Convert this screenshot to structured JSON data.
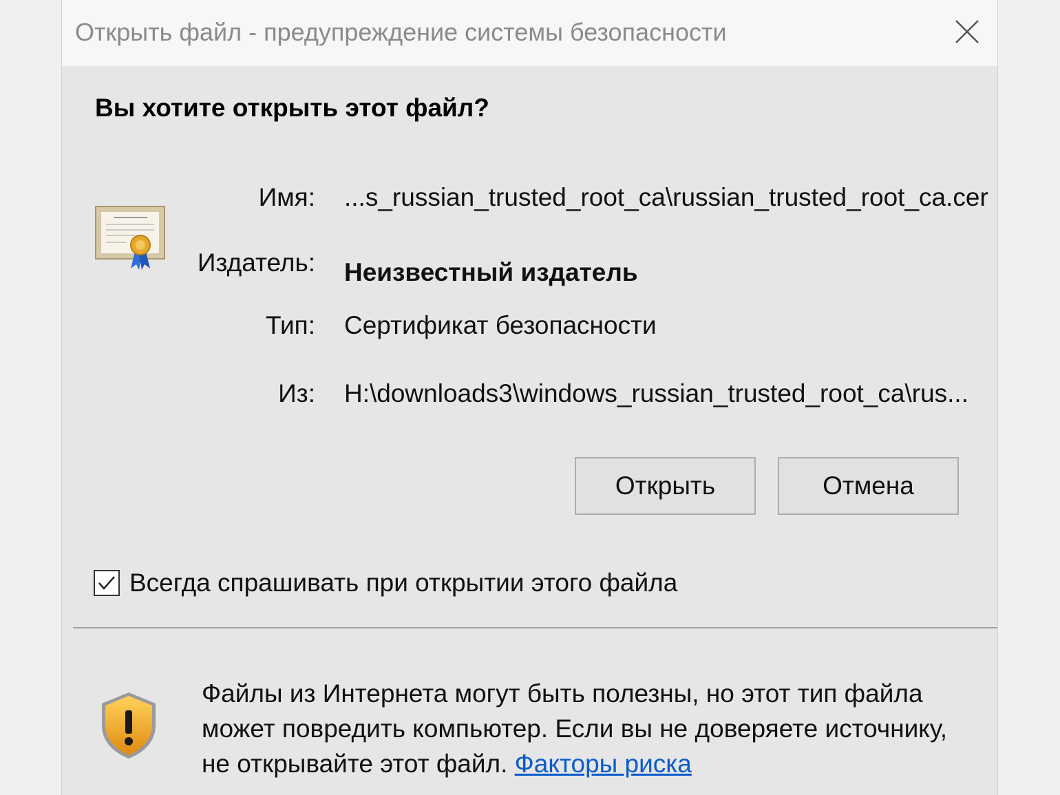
{
  "window": {
    "title": "Открыть файл - предупреждение системы безопасности"
  },
  "dialog": {
    "question": "Вы хотите открыть этот файл?",
    "fields": {
      "name_label": "Имя:",
      "name_value": "...s_russian_trusted_root_ca\\russian_trusted_root_ca.cer",
      "publisher_label": "Издатель:",
      "publisher_value": "Неизвестный издатель",
      "type_label": "Тип:",
      "type_value": "Сертификат безопасности",
      "from_label": "Из:",
      "from_value": "H:\\downloads3\\windows_russian_trusted_root_ca\\rus..."
    },
    "buttons": {
      "open_label": "Открыть",
      "cancel_label": "Отмена"
    },
    "checkbox": {
      "label": "Всегда спрашивать при открытии этого файла",
      "checked": true
    },
    "warning": {
      "text": "Файлы из Интернета могут быть полезны, но этот тип файла может повредить компьютер. Если вы не доверяете источнику, не открывайте этот файл. ",
      "link_label": "Факторы риска"
    }
  },
  "icons": {
    "certificate": "certificate-icon",
    "shield": "shield-warning-icon",
    "close": "close-icon",
    "check": "checkmark-icon"
  },
  "colors": {
    "link": "#0a5ccc",
    "shield_fill": "#f5a623"
  }
}
